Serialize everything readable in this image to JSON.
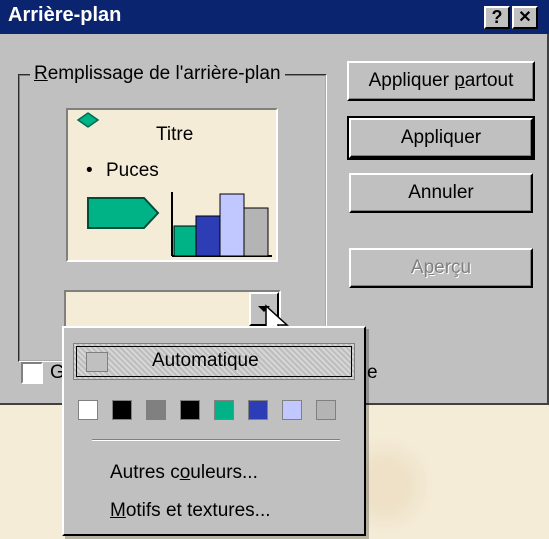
{
  "window": {
    "title": "Arrière-plan",
    "help_button": "?",
    "close_button": "✕"
  },
  "group": {
    "label_prefix": "R",
    "label_rest": "emplissage de l'arrière-plan"
  },
  "preview": {
    "title": "Titre",
    "bullet": "•",
    "bullet_text": "Puces"
  },
  "buttons": {
    "apply_all_a": "Appliquer ",
    "apply_all_u": "p",
    "apply_all_b": "artout",
    "apply": "Appliquer",
    "cancel": "Annuler",
    "preview_a": "A",
    "preview_u": "p",
    "preview_b": "erçu"
  },
  "checkbox": {
    "label_fragment_left": "G",
    "label_fragment_right": "e"
  },
  "popup": {
    "automatic": "Automatique",
    "more_colors_a": "Autres c",
    "more_colors_u": "o",
    "more_colors_b": "uleurs...",
    "patterns_u": "M",
    "patterns_b": "otifs et textures..."
  },
  "colors": {
    "titlebar": "#0a2470",
    "dialog": "#c0c0c0",
    "teal": "#00b386",
    "blue": "#2d3db5",
    "lavender": "#c0c8ff",
    "gray": "#b4b4b4",
    "swatches": [
      "#ffffff",
      "#000000",
      "#808080",
      "#000000",
      "#00b386",
      "#2d3db5",
      "#c0c8ff",
      "#b4b4b4"
    ]
  }
}
